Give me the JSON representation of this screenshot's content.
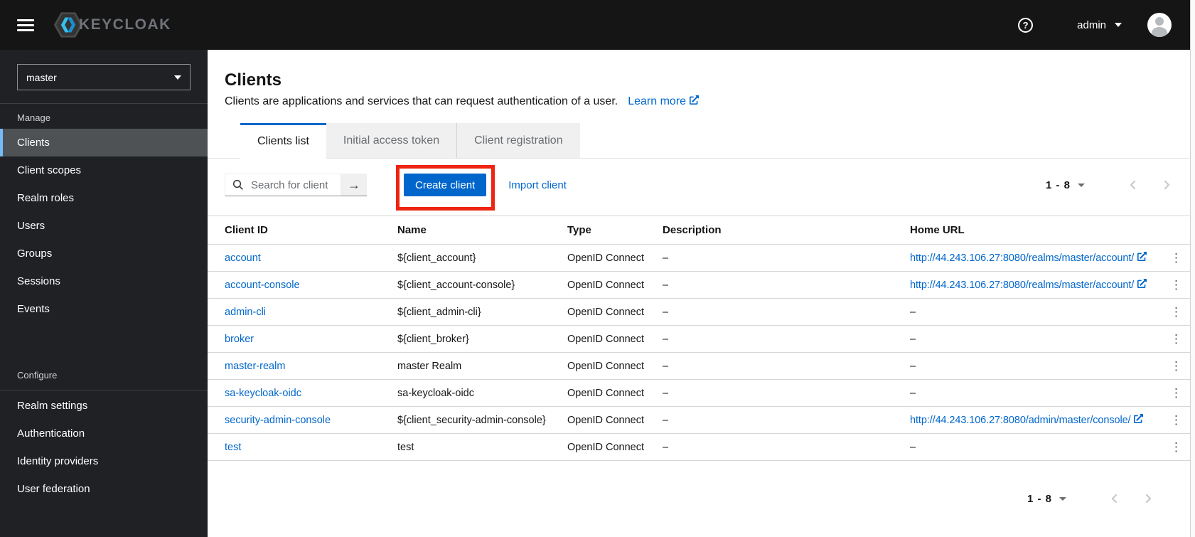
{
  "colors": {
    "accent_blue": "#0066cc",
    "annotation_red": "#ee2412",
    "nav_selected_border": "#73bcf7",
    "masthead_bg": "#151515",
    "sidebar_bg": "#1f2125"
  },
  "icons": {
    "help": "?",
    "submit_arrow": "→",
    "kebab": "⋮"
  },
  "header": {
    "brand": "KEYCLOAK",
    "username": "admin"
  },
  "sidebar": {
    "realm_selector": {
      "value": "master"
    },
    "sections": [
      {
        "title": "Manage",
        "items": [
          {
            "label": "Clients",
            "active": true
          },
          {
            "label": "Client scopes"
          },
          {
            "label": "Realm roles"
          },
          {
            "label": "Users"
          },
          {
            "label": "Groups"
          },
          {
            "label": "Sessions"
          },
          {
            "label": "Events"
          }
        ]
      },
      {
        "title": "Configure",
        "items": [
          {
            "label": "Realm settings"
          },
          {
            "label": "Authentication"
          },
          {
            "label": "Identity providers"
          },
          {
            "label": "User federation"
          }
        ]
      }
    ]
  },
  "main": {
    "title": "Clients",
    "description": "Clients are applications and services that can request authentication of a user.",
    "learn_more_label": "Learn more",
    "tabs": [
      {
        "label": "Clients list",
        "active": true
      },
      {
        "label": "Initial access token",
        "active": false
      },
      {
        "label": "Client registration",
        "active": false
      }
    ],
    "toolbar": {
      "search_placeholder": "Search for client",
      "create_button_label": "Create client",
      "import_link_label": "Import client",
      "pagination_range": "1 - 8"
    },
    "table": {
      "columns": [
        "Client ID",
        "Name",
        "Type",
        "Description",
        "Home URL"
      ],
      "rows": [
        {
          "client_id": "account",
          "name": "${client_account}",
          "type": "OpenID Connect",
          "description": "–",
          "home_url": "http://44.243.106.27:8080/realms/master/account/"
        },
        {
          "client_id": "account-console",
          "name": "${client_account-console}",
          "type": "OpenID Connect",
          "description": "–",
          "home_url": "http://44.243.106.27:8080/realms/master/account/"
        },
        {
          "client_id": "admin-cli",
          "name": "${client_admin-cli}",
          "type": "OpenID Connect",
          "description": "–",
          "home_url": "–"
        },
        {
          "client_id": "broker",
          "name": "${client_broker}",
          "type": "OpenID Connect",
          "description": "–",
          "home_url": "–"
        },
        {
          "client_id": "master-realm",
          "name": "master Realm",
          "type": "OpenID Connect",
          "description": "–",
          "home_url": "–"
        },
        {
          "client_id": "sa-keycloak-oidc",
          "name": "sa-keycloak-oidc",
          "type": "OpenID Connect",
          "description": "–",
          "home_url": "–"
        },
        {
          "client_id": "security-admin-console",
          "name": "${client_security-admin-console}",
          "type": "OpenID Connect",
          "description": "–",
          "home_url": "http://44.243.106.27:8080/admin/master/console/"
        },
        {
          "client_id": "test",
          "name": "test",
          "type": "OpenID Connect",
          "description": "–",
          "home_url": "–"
        }
      ]
    },
    "pagination_bottom_range": "1 - 8"
  }
}
